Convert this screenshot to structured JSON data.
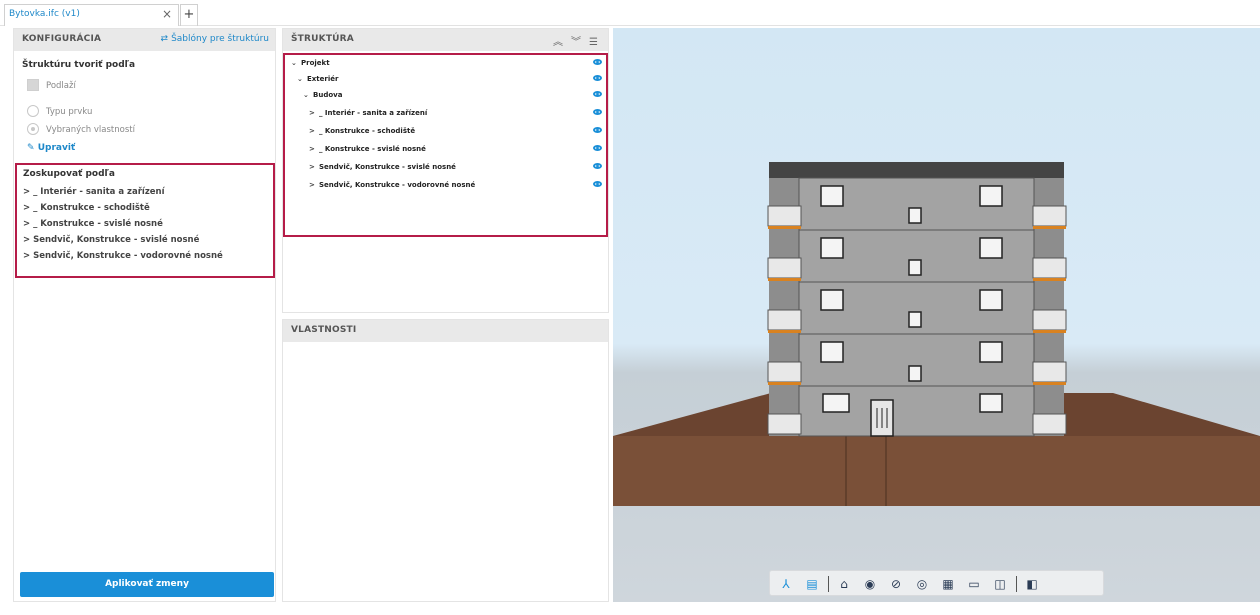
{
  "tabs": [
    {
      "label": "Bytovka.ifc (v1)",
      "close": "×"
    }
  ],
  "tab_add": "+",
  "config": {
    "title": "KONFIGURÁCIA",
    "templates_link": "Šablóny pre štruktúru",
    "structure_by_label": "Štruktúru tvoriť podľa",
    "floor_option": "Podlaží",
    "radio_type": "Typu prvku",
    "radio_selected_props": "Vybraných vlastností",
    "edit_link": "Upraviť",
    "group_by_label": "Zoskupovať podľa",
    "group_items": [
      "> _ Interiér - sanita a zařízení",
      "> _ Konstrukce - schodiště",
      "> _ Konstrukce - svislé nosné",
      "> Sendvič, Konstrukce - svislé nosné",
      "> Sendvič, Konstrukce - vodorovné nosné"
    ],
    "apply_button": "Aplikovať zmeny"
  },
  "structure": {
    "title": "ŠTRUKTÚRA",
    "tree": [
      {
        "caret": "⌄",
        "label": "Projekt"
      },
      {
        "caret": "⌄",
        "label": "Exteriér"
      },
      {
        "caret": "⌄",
        "label": "Budova"
      },
      {
        "caret": ">",
        "label": "_ Interiér - sanita a zařízení"
      },
      {
        "caret": ">",
        "label": "_ Konstrukce - schodiště"
      },
      {
        "caret": ">",
        "label": "_ Konstrukce - svislé nosné"
      },
      {
        "caret": ">",
        "label": "Sendvič, Konstrukce - svislé nosné"
      },
      {
        "caret": ">",
        "label": "Sendvič, Konstrukce - vodorovné nosné"
      }
    ]
  },
  "properties": {
    "title": "VLASTNOSTI"
  },
  "colors": {
    "accent": "#1a8fd8",
    "highlight_border": "#b51c48",
    "ground": "#7a5038",
    "facade": "#a3a3a3"
  },
  "viewer_toolbar": [
    "axes-icon",
    "model-tree-icon",
    "home-icon",
    "eye-icon",
    "eye-hidden-icon",
    "target-icon",
    "section-box-icon",
    "ruler-icon",
    "split-view-icon",
    "compare-icon"
  ]
}
